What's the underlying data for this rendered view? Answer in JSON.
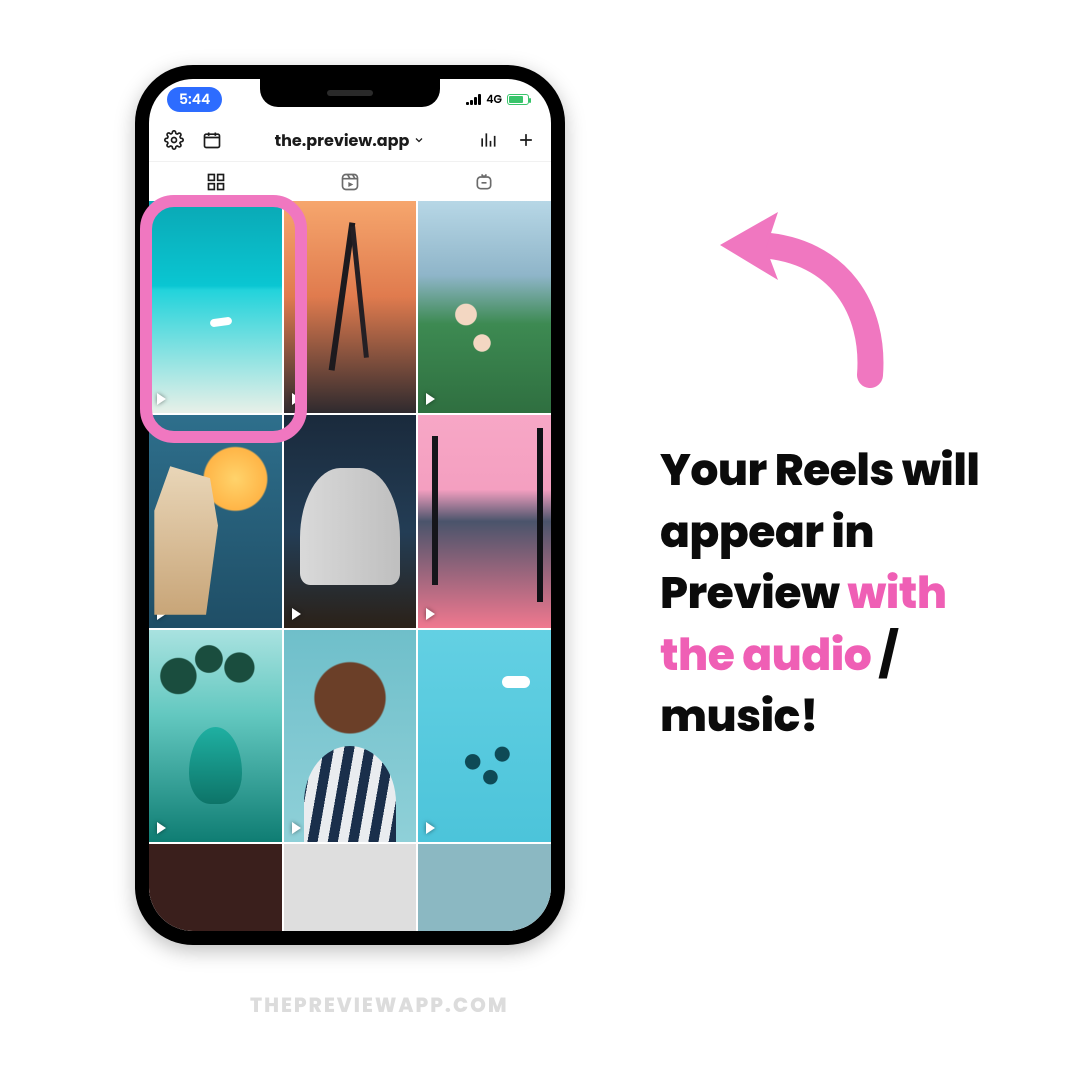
{
  "status_bar": {
    "time": "5:44",
    "network": "4G"
  },
  "toolbar": {
    "username": "the.preview.app"
  },
  "caption": {
    "part1": "Your Reels will appear in Preview ",
    "highlight": "with the audio",
    "part2": " / music!"
  },
  "watermark": "THEPREVIEWAPP.COM",
  "colors": {
    "pink": "#ef5fb5"
  }
}
